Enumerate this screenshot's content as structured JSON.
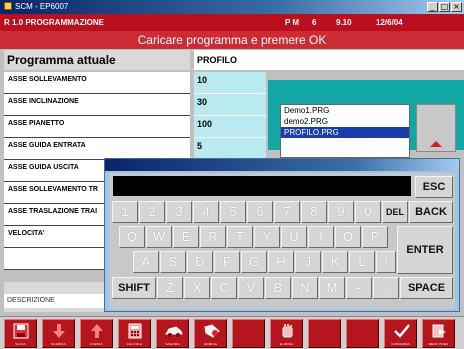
{
  "window": {
    "title": "SCM - EP6007",
    "controls": [
      "_",
      "□",
      "×"
    ]
  },
  "status": {
    "version_mode": "R 1.0  PROGRAMMAZIONE",
    "pm_label": "P M",
    "pm_value": "6",
    "time": "9.10",
    "date": "12/6/04"
  },
  "prompt": "Caricare programma e premere OK",
  "header": {
    "label": "Programma attuale",
    "value": "PROFILO"
  },
  "parameters": [
    {
      "label": "ASSE SOLLEVAMENTO",
      "value": "10"
    },
    {
      "label": "ASSE INCLINAZIONE",
      "value": "30"
    },
    {
      "label": "ASSE PIANETTO",
      "value": "100"
    },
    {
      "label": "ASSE GUIDA ENTRATA",
      "value": "5"
    },
    {
      "label": "ASSE GUIDA USCITA",
      "value": ""
    },
    {
      "label": "ASSE SOLLEVAMENTO TR",
      "value": ""
    },
    {
      "label": "ASSE TRASLAZIONE TRAI",
      "value": ""
    },
    {
      "label": "VELOCITA'",
      "value": ""
    },
    {
      "label": "",
      "value": ""
    }
  ],
  "files": {
    "items": [
      "Demo1.PRG",
      "demo2.PRG",
      "PROFILO.PRG"
    ],
    "selected_index": 2
  },
  "description_label": "DESCRIZIONE",
  "keyboard": {
    "esc": "ESC",
    "back": "BACK",
    "del": "DEL",
    "enter": "ENTER",
    "shift": "SHIFT",
    "space": "SPACE",
    "row_numbers": [
      "1",
      "2",
      "3",
      "4",
      "5",
      "6",
      "7",
      "8",
      "9",
      "0"
    ],
    "row_qwerty": [
      "Q",
      "W",
      "E",
      "R",
      "T",
      "Y",
      "U",
      "I",
      "O",
      "P"
    ],
    "row_asdf": [
      "A",
      "S",
      "D",
      "F",
      "G",
      "H",
      "J",
      "K",
      "L",
      "/"
    ],
    "row_zxcv": [
      "Z",
      "X",
      "C",
      "V",
      "B",
      "N",
      "M",
      "-",
      "_"
    ]
  },
  "toolbar": {
    "buttons": [
      {
        "icon": "save-icon",
        "label": "SALVA"
      },
      {
        "icon": "arrow-down-icon",
        "label": "SCARICA"
      },
      {
        "icon": "arrow-up-icon",
        "label": "CARICA"
      },
      {
        "icon": "calculator-icon",
        "label": "CALCOLA"
      },
      {
        "icon": "car-icon",
        "label": "SAGOMA"
      },
      {
        "icon": "tag-icon",
        "label": "NOMINA"
      },
      {
        "icon": "empty",
        "label": ""
      },
      {
        "icon": "hand-icon",
        "label": "ELIMINA"
      },
      {
        "icon": "empty",
        "label": ""
      },
      {
        "icon": "empty",
        "label": ""
      },
      {
        "icon": "check-icon",
        "label": "CONFERMA"
      },
      {
        "icon": "exit-icon",
        "label": "MENU PREC"
      }
    ]
  }
}
